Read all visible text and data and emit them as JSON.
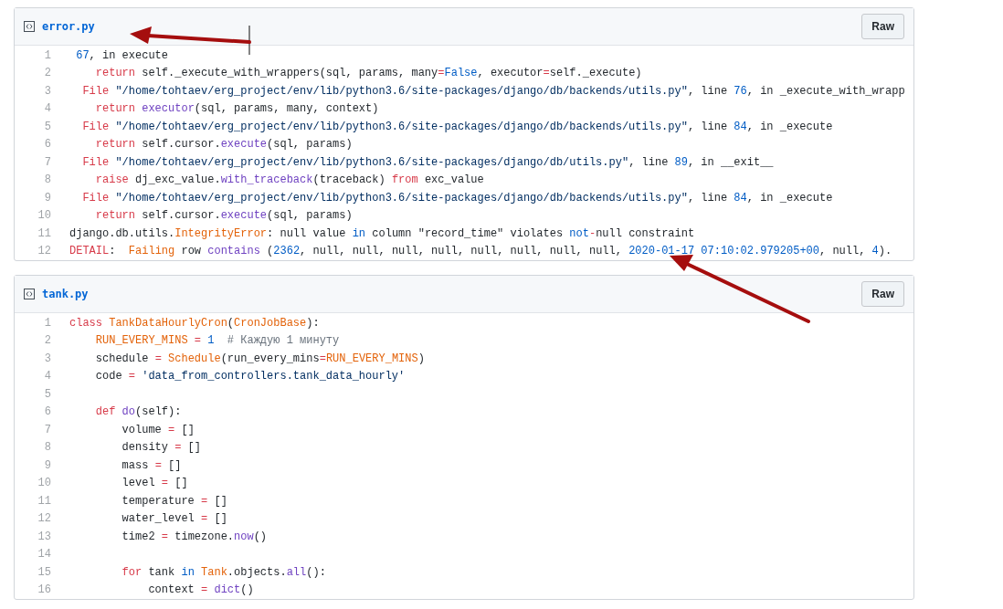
{
  "files": [
    {
      "name": "error.py",
      "button": "Raw",
      "lines": [
        {
          "n": "1",
          "tokens": [
            {
              "text": " 67",
              "kind": "num"
            },
            {
              "text": ", in execute",
              "kind": "plain"
            }
          ]
        },
        {
          "n": "2",
          "tokens": [
            {
              "text": "    return",
              "kind": "kw"
            },
            {
              "text": " self._execute_with_wrappers(sql, params, many",
              "kind": "plain"
            },
            {
              "text": "=",
              "kind": "kw"
            },
            {
              "text": "False",
              "kind": "num"
            },
            {
              "text": ", executor",
              "kind": "plain"
            },
            {
              "text": "=",
              "kind": "kw"
            },
            {
              "text": "self._execute)",
              "kind": "plain"
            }
          ]
        },
        {
          "n": "3",
          "tokens": [
            {
              "text": "  File",
              "kind": "kw"
            },
            {
              "text": " \"/home/tohtaev/erg_project/env/lib/python3.6/site-packages/django/db/backends/utils.py\"",
              "kind": "str"
            },
            {
              "text": ", line ",
              "kind": "plain"
            },
            {
              "text": "76",
              "kind": "num"
            },
            {
              "text": ", in _execute_with_wrapp",
              "kind": "plain"
            }
          ]
        },
        {
          "n": "4",
          "tokens": [
            {
              "text": "    return",
              "kind": "kw"
            },
            {
              "text": " executor",
              "kind": "fn"
            },
            {
              "text": "(sql, params, many, context)",
              "kind": "plain"
            }
          ]
        },
        {
          "n": "5",
          "tokens": [
            {
              "text": "  File",
              "kind": "kw"
            },
            {
              "text": " \"/home/tohtaev/erg_project/env/lib/python3.6/site-packages/django/db/backends/utils.py\"",
              "kind": "str"
            },
            {
              "text": ", line ",
              "kind": "plain"
            },
            {
              "text": "84",
              "kind": "num"
            },
            {
              "text": ", in _execute",
              "kind": "plain"
            }
          ]
        },
        {
          "n": "6",
          "tokens": [
            {
              "text": "    return",
              "kind": "kw"
            },
            {
              "text": " self.cursor.",
              "kind": "plain"
            },
            {
              "text": "execute",
              "kind": "fn"
            },
            {
              "text": "(sql, params)",
              "kind": "plain"
            }
          ]
        },
        {
          "n": "7",
          "tokens": [
            {
              "text": "  File",
              "kind": "kw"
            },
            {
              "text": " \"/home/tohtaev/erg_project/env/lib/python3.6/site-packages/django/db/utils.py\"",
              "kind": "str"
            },
            {
              "text": ", line ",
              "kind": "plain"
            },
            {
              "text": "89",
              "kind": "num"
            },
            {
              "text": ", in __exit__",
              "kind": "plain"
            }
          ]
        },
        {
          "n": "8",
          "tokens": [
            {
              "text": "    raise",
              "kind": "kw"
            },
            {
              "text": " dj_exc_value.",
              "kind": "plain"
            },
            {
              "text": "with_traceback",
              "kind": "fn"
            },
            {
              "text": "(traceback) ",
              "kind": "plain"
            },
            {
              "text": "from",
              "kind": "kw"
            },
            {
              "text": " exc_value",
              "kind": "plain"
            }
          ]
        },
        {
          "n": "9",
          "tokens": [
            {
              "text": "  File",
              "kind": "kw"
            },
            {
              "text": " \"/home/tohtaev/erg_project/env/lib/python3.6/site-packages/django/db/backends/utils.py\"",
              "kind": "str"
            },
            {
              "text": ", line ",
              "kind": "plain"
            },
            {
              "text": "84",
              "kind": "num"
            },
            {
              "text": ", in _execute",
              "kind": "plain"
            }
          ]
        },
        {
          "n": "10",
          "tokens": [
            {
              "text": "    return",
              "kind": "kw"
            },
            {
              "text": " self.cursor.",
              "kind": "plain"
            },
            {
              "text": "execute",
              "kind": "fn"
            },
            {
              "text": "(sql, params)",
              "kind": "plain"
            }
          ]
        },
        {
          "n": "11",
          "tokens": [
            {
              "text": "django.db.utils.",
              "kind": "plain"
            },
            {
              "text": "IntegrityError",
              "kind": "cls"
            },
            {
              "text": ": null value ",
              "kind": "plain"
            },
            {
              "text": "in",
              "kind": "num"
            },
            {
              "text": " column \"record_time\" violates ",
              "kind": "plain"
            },
            {
              "text": "not",
              "kind": "num"
            },
            {
              "text": "-",
              "kind": "kw"
            },
            {
              "text": "null constraint",
              "kind": "plain"
            }
          ]
        },
        {
          "n": "12",
          "tokens": [
            {
              "text": "DETAIL",
              "kind": "kw"
            },
            {
              "text": ":  ",
              "kind": "plain"
            },
            {
              "text": "Failing",
              "kind": "cls"
            },
            {
              "text": " row ",
              "kind": "plain"
            },
            {
              "text": "contains",
              "kind": "fn"
            },
            {
              "text": " (",
              "kind": "plain"
            },
            {
              "text": "2362",
              "kind": "num"
            },
            {
              "text": ", null, null, null, null, null, null, null, null, ",
              "kind": "plain"
            },
            {
              "text": "2020-01-17 07:10:02.979205+00",
              "kind": "num"
            },
            {
              "text": ", null, ",
              "kind": "plain"
            },
            {
              "text": "4",
              "kind": "num"
            },
            {
              "text": ").",
              "kind": "plain"
            }
          ]
        }
      ]
    },
    {
      "name": "tank.py",
      "button": "Raw",
      "lines": [
        {
          "n": "1",
          "tokens": [
            {
              "text": "class",
              "kind": "kw"
            },
            {
              "text": " TankDataHourlyCron",
              "kind": "cls"
            },
            {
              "text": "(",
              "kind": "plain"
            },
            {
              "text": "CronJobBase",
              "kind": "cls"
            },
            {
              "text": "):",
              "kind": "plain"
            }
          ]
        },
        {
          "n": "2",
          "tokens": [
            {
              "text": "    RUN_EVERY_MINS",
              "kind": "cls"
            },
            {
              "text": " =",
              "kind": "kw"
            },
            {
              "text": " 1",
              "kind": "num"
            },
            {
              "text": "  # Каждую 1 минуту",
              "kind": "comment"
            }
          ]
        },
        {
          "n": "3",
          "tokens": [
            {
              "text": "    schedule ",
              "kind": "plain"
            },
            {
              "text": "=",
              "kind": "kw"
            },
            {
              "text": " Schedule",
              "kind": "cls"
            },
            {
              "text": "(run_every_mins",
              "kind": "plain"
            },
            {
              "text": "=",
              "kind": "kw"
            },
            {
              "text": "RUN_EVERY_MINS",
              "kind": "cls"
            },
            {
              "text": ")",
              "kind": "plain"
            }
          ]
        },
        {
          "n": "4",
          "tokens": [
            {
              "text": "    code ",
              "kind": "plain"
            },
            {
              "text": "=",
              "kind": "kw"
            },
            {
              "text": " 'data_from_controllers.tank_data_hourly'",
              "kind": "str"
            }
          ]
        },
        {
          "n": "5"
        },
        {
          "n": "6",
          "tokens": [
            {
              "text": "    def",
              "kind": "kw"
            },
            {
              "text": " do",
              "kind": "fn"
            },
            {
              "text": "(self):",
              "kind": "plain"
            }
          ]
        },
        {
          "n": "7",
          "tokens": [
            {
              "text": "        volume ",
              "kind": "plain"
            },
            {
              "text": "=",
              "kind": "kw"
            },
            {
              "text": " []",
              "kind": "plain"
            }
          ]
        },
        {
          "n": "8",
          "tokens": [
            {
              "text": "        density ",
              "kind": "plain"
            },
            {
              "text": "=",
              "kind": "kw"
            },
            {
              "text": " []",
              "kind": "plain"
            }
          ]
        },
        {
          "n": "9",
          "tokens": [
            {
              "text": "        mass ",
              "kind": "plain"
            },
            {
              "text": "=",
              "kind": "kw"
            },
            {
              "text": " []",
              "kind": "plain"
            }
          ]
        },
        {
          "n": "10",
          "tokens": [
            {
              "text": "        level ",
              "kind": "plain"
            },
            {
              "text": "=",
              "kind": "kw"
            },
            {
              "text": " []",
              "kind": "plain"
            }
          ]
        },
        {
          "n": "11",
          "tokens": [
            {
              "text": "        temperature ",
              "kind": "plain"
            },
            {
              "text": "=",
              "kind": "kw"
            },
            {
              "text": " []",
              "kind": "plain"
            }
          ]
        },
        {
          "n": "12",
          "tokens": [
            {
              "text": "        water_level ",
              "kind": "plain"
            },
            {
              "text": "=",
              "kind": "kw"
            },
            {
              "text": " []",
              "kind": "plain"
            }
          ]
        },
        {
          "n": "13",
          "tokens": [
            {
              "text": "        time2 ",
              "kind": "plain"
            },
            {
              "text": "=",
              "kind": "kw"
            },
            {
              "text": " timezone.",
              "kind": "plain"
            },
            {
              "text": "now",
              "kind": "fn"
            },
            {
              "text": "()",
              "kind": "plain"
            }
          ]
        },
        {
          "n": "14"
        },
        {
          "n": "15",
          "tokens": [
            {
              "text": "        for",
              "kind": "kw"
            },
            {
              "text": " tank ",
              "kind": "plain"
            },
            {
              "text": "in",
              "kind": "num"
            },
            {
              "text": " Tank",
              "kind": "cls"
            },
            {
              "text": ".objects.",
              "kind": "plain"
            },
            {
              "text": "all",
              "kind": "fn"
            },
            {
              "text": "():",
              "kind": "plain"
            }
          ]
        },
        {
          "n": "16",
          "tokens": [
            {
              "text": "            context ",
              "kind": "plain"
            },
            {
              "text": "=",
              "kind": "kw"
            },
            {
              "text": " dict",
              "kind": "fn"
            },
            {
              "text": "()",
              "kind": "plain"
            }
          ]
        }
      ]
    }
  ]
}
